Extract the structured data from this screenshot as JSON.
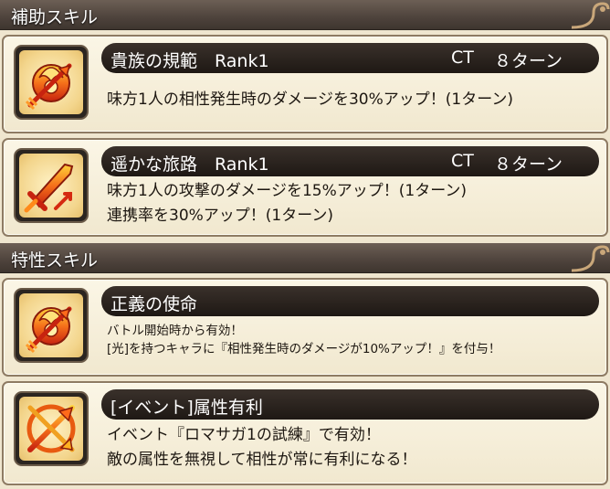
{
  "support_section": {
    "title": "補助スキル",
    "skills": [
      {
        "name": "貴族の規範　Rank1",
        "ct_label": "CT",
        "ct_value": "８ターン",
        "icon": "flame-crest-arrow-icon",
        "lines": [
          "味方1人の相性発生時のダメージを30%アップ！(1ターン)"
        ]
      },
      {
        "name": "遥かな旅路　Rank1",
        "ct_label": "CT",
        "ct_value": "８ターン",
        "icon": "sword-arrow-icon",
        "lines": [
          "味方1人の攻撃のダメージを15%アップ！(1ターン)",
          "連携率を30%アップ！(1ターン)"
        ]
      }
    ]
  },
  "trait_section": {
    "title": "特性スキル",
    "skills": [
      {
        "name": "正義の使命",
        "icon": "flame-crest-arrow-icon",
        "lines": [
          "バトル開始時から有効！",
          "[光]を持つキャラに『相性発生時のダメージが10%アップ！』を付与！"
        ]
      },
      {
        "name": "[イベント]属性有利",
        "icon": "crossed-arrows-icon",
        "lines": [
          "イベント『ロマサガ1の試練』で有効！",
          "敵の属性を無視して相性が常に有利になる！"
        ]
      }
    ]
  }
}
